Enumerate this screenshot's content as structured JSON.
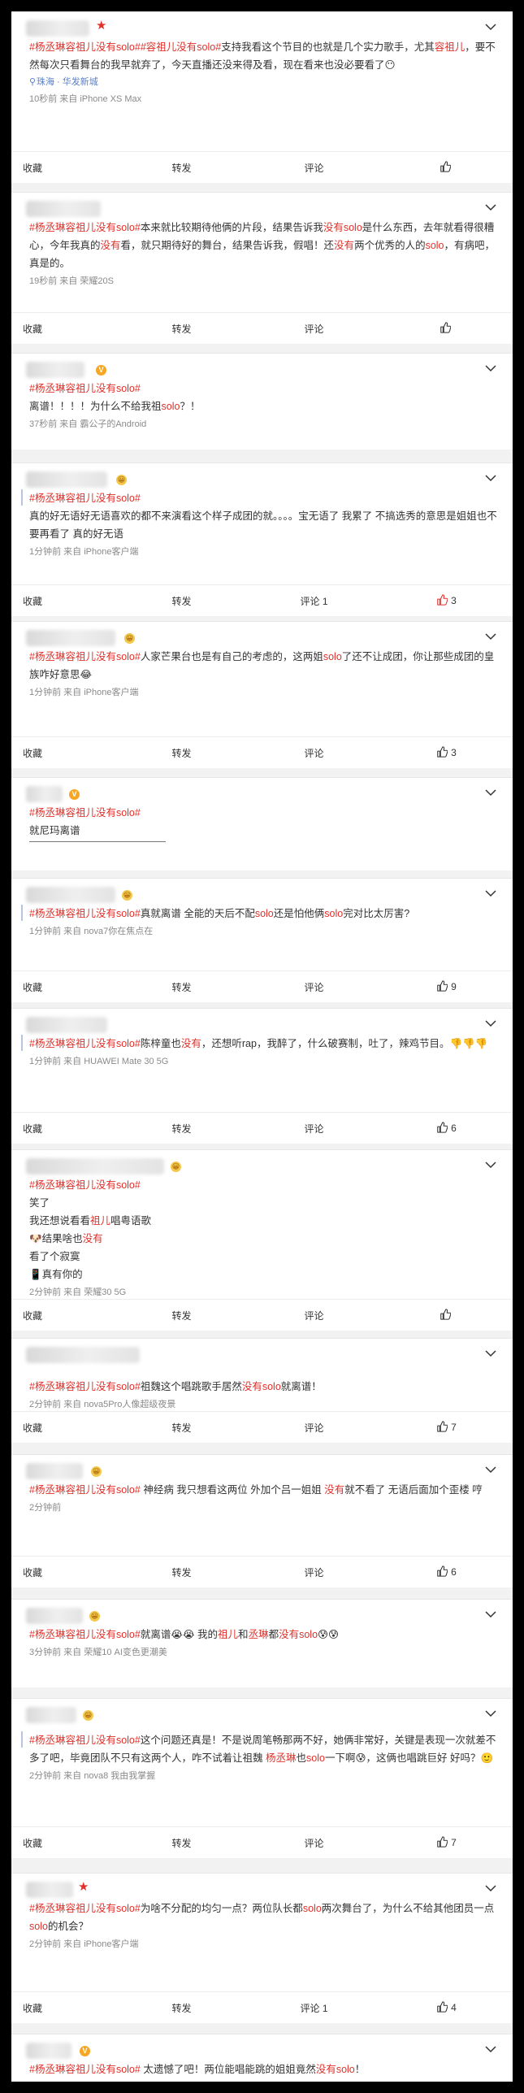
{
  "labels": {
    "collect": "收藏",
    "repost": "转发",
    "comment": "评论"
  },
  "colors": {
    "accent": "#e0312b",
    "meta": "#8a8a8a",
    "location": "#5b7fc7"
  },
  "posts": [
    {
      "badge": "★",
      "segments": [
        {
          "t": "#杨丞琳容祖儿没有solo#",
          "c": "tag"
        },
        {
          "t": "#容祖儿没有solo#",
          "c": "tag"
        },
        {
          "t": "支持我看这个节目的也就是几个实力歌手，尤其",
          "c": ""
        },
        {
          "t": "容祖儿",
          "c": "hl"
        },
        {
          "t": "，要不然每次只看舞台的我早就弃了，今天直播还没来得及看，现在看来也没必要看了😶",
          "c": ""
        }
      ],
      "location": "珠海 · 华发新城",
      "meta": "10秒前  来自 iPhone XS Max",
      "comment": "评论",
      "like": ""
    },
    {
      "badge": "",
      "segments": [
        {
          "t": "#杨丞琳容祖儿没有solo#",
          "c": "tag"
        },
        {
          "t": "本来就比较期待他俩的片段，结果告诉我",
          "c": ""
        },
        {
          "t": "没有solo",
          "c": "hl"
        },
        {
          "t": "是什么东西，去年就看得很糟心，今年我真的",
          "c": ""
        },
        {
          "t": "没有",
          "c": "hl"
        },
        {
          "t": "看，就只期待好的舞台，结果告诉我，假唱！还",
          "c": ""
        },
        {
          "t": "没有",
          "c": "hl"
        },
        {
          "t": "两个优秀的人的",
          "c": ""
        },
        {
          "t": "solo",
          "c": "hl"
        },
        {
          "t": "，有病吧，真是的。",
          "c": ""
        }
      ],
      "meta": "19秒前  来自 荣耀20S",
      "comment": "评论",
      "like": ""
    },
    {
      "badge": "V",
      "segments": [
        {
          "t": "#杨丞琳容祖儿没有solo#",
          "c": "tag"
        },
        {
          "t": "\n离谱！！！！为什么不给我祖",
          "c": ""
        },
        {
          "t": "solo",
          "c": "hl"
        },
        {
          "t": "？！",
          "c": ""
        }
      ],
      "meta": "37秒前  来自 霸公子的Android",
      "comment": "",
      "like": ""
    },
    {
      "badge": "😀",
      "segments": [
        {
          "t": "#杨丞琳容祖儿没有solo#",
          "c": "tag"
        },
        {
          "t": "\n真的好无语好无语喜欢的都不来演看这个样子成团的就。。。。宝无语了 我累了 不搞选秀的意思是姐姐也不要再看了 真的好无语",
          "c": ""
        }
      ],
      "meta": "1分钟前  来自 iPhone客户端",
      "comment": "评论 1",
      "like": "3",
      "likeActive": true
    },
    {
      "badge": "😀",
      "segments": [
        {
          "t": "#杨丞琳容祖儿没有solo#",
          "c": "tag"
        },
        {
          "t": "人家芒果台也是有自己的考虑的，这两姐",
          "c": ""
        },
        {
          "t": "solo",
          "c": "hl"
        },
        {
          "t": "了还不让成团，你让那些成团的皇族咋好意思😂",
          "c": ""
        }
      ],
      "meta": "1分钟前  来自 iPhone客户端",
      "comment": "评论",
      "like": "3"
    },
    {
      "badge": "V",
      "segments": [
        {
          "t": "#杨丞琳容祖儿没有solo#",
          "c": "tag"
        },
        {
          "t": "\n就尼玛离谱",
          "c": ""
        }
      ],
      "meta": "",
      "comment": "",
      "like": ""
    },
    {
      "badge": "😀",
      "segments": [
        {
          "t": "#杨丞琳容祖儿没有solo#",
          "c": "tag"
        },
        {
          "t": "真就离谱 全能的天后不配",
          "c": ""
        },
        {
          "t": "solo",
          "c": "hl"
        },
        {
          "t": "还是怕他俩",
          "c": ""
        },
        {
          "t": "solo",
          "c": "hl"
        },
        {
          "t": "完对比太厉害?",
          "c": ""
        }
      ],
      "meta": "1分钟前  来自 nova7你在焦点在",
      "comment": "评论",
      "like": "9"
    },
    {
      "badge": "",
      "segments": [
        {
          "t": "#杨丞琳容祖儿没有solo#",
          "c": "tag"
        },
        {
          "t": "陈梓童也",
          "c": ""
        },
        {
          "t": "没有",
          "c": "hl"
        },
        {
          "t": "，还想听rap，我醉了，什么破赛制，吐了，辣鸡节目。👎👎👎",
          "c": ""
        }
      ],
      "meta": "1分钟前  来自 HUAWEI Mate 30 5G",
      "comment": "评论",
      "like": "6"
    },
    {
      "badge": "😀",
      "segments": [
        {
          "t": "#杨丞琳容祖儿没有solo#",
          "c": "tag"
        },
        {
          "t": "\n笑了\n我还想说看看",
          "c": ""
        },
        {
          "t": "祖儿",
          "c": "hl"
        },
        {
          "t": "唱粤语歌\n🐶结果啥也",
          "c": ""
        },
        {
          "t": "没有",
          "c": "hl"
        },
        {
          "t": "\n看了个寂寞\n📱真有你的",
          "c": ""
        }
      ],
      "meta": "2分钟前  来自 荣耀30 5G",
      "comment": "评论",
      "like": ""
    },
    {
      "badge": "",
      "segments": [
        {
          "t": "#杨丞琳容祖儿没有solo#",
          "c": "tag"
        },
        {
          "t": "祖魏这个唱跳歌手居然",
          "c": ""
        },
        {
          "t": "没有solo",
          "c": "hl"
        },
        {
          "t": "就离谱！",
          "c": ""
        }
      ],
      "meta": "2分钟前  来自 nova5Pro人像超级夜景",
      "comment": "评论",
      "like": "7"
    },
    {
      "badge": "😀",
      "segments": [
        {
          "t": "#杨丞琳容祖儿没有solo#",
          "c": "tag"
        },
        {
          "t": " 神经病 我只想看这两位 外加个吕一姐姐 ",
          "c": ""
        },
        {
          "t": "没有",
          "c": "hl"
        },
        {
          "t": "就不看了 无语后面加个歪楼 哼",
          "c": ""
        }
      ],
      "meta": "2分钟前",
      "comment": "评论",
      "like": "6"
    },
    {
      "badge": "😀",
      "segments": [
        {
          "t": "#杨丞琳容祖儿没有solo#",
          "c": "tag"
        },
        {
          "t": "就离谱😭😭 我的",
          "c": ""
        },
        {
          "t": "祖儿",
          "c": "hl"
        },
        {
          "t": "和",
          "c": ""
        },
        {
          "t": "丞琳",
          "c": "hl"
        },
        {
          "t": "都",
          "c": ""
        },
        {
          "t": "没有solo",
          "c": "hl"
        },
        {
          "t": "😰😰",
          "c": ""
        }
      ],
      "meta": "3分钟前  来自 荣耀10 AI变色更潮美",
      "comment": "评论",
      "like": ""
    },
    {
      "badge": "😀",
      "segments": [
        {
          "t": "#杨丞琳容祖儿没有solo#",
          "c": "tag"
        },
        {
          "t": "这个问题还真是！不是说周笔畅那两不好，她俩非常好，关键是表现一次就差不多了吧，毕竟团队不只有这两个人，咋不试着让祖魏 ",
          "c": ""
        },
        {
          "t": "杨丞琳",
          "c": "hl"
        },
        {
          "t": "也",
          "c": ""
        },
        {
          "t": "solo",
          "c": "hl"
        },
        {
          "t": "一下啊😰，这俩也唱跳巨好 好吗？🙂",
          "c": ""
        }
      ],
      "meta": "2分钟前  来自 nova8 我由我掌握",
      "comment": "评论",
      "like": "7"
    },
    {
      "badge": "★",
      "segments": [
        {
          "t": "#杨丞琳容祖儿没有solo#",
          "c": "tag"
        },
        {
          "t": "为啥不分配的均匀一点？两位队长都",
          "c": ""
        },
        {
          "t": "solo",
          "c": "hl"
        },
        {
          "t": "两次舞台了，为什么不给其他团员一点",
          "c": ""
        },
        {
          "t": "solo",
          "c": "hl"
        },
        {
          "t": "的机会？",
          "c": ""
        }
      ],
      "meta": "2分钟前  来自 iPhone客户端",
      "comment": "评论 1",
      "like": "4"
    },
    {
      "badge": "V",
      "segments": [
        {
          "t": "#杨丞琳容祖儿没有solo#",
          "c": "tag"
        },
        {
          "t": " 太遗憾了吧！两位能唱能跳的姐姐竟然",
          "c": ""
        },
        {
          "t": "没有solo",
          "c": "hl"
        },
        {
          "t": "！",
          "c": ""
        }
      ],
      "meta": "",
      "comment": "",
      "like": ""
    }
  ]
}
